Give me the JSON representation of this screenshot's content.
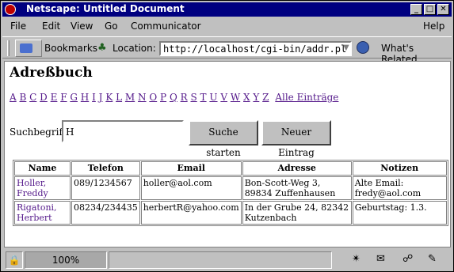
{
  "window": {
    "title": "Netscape: Untitled Document"
  },
  "menu": [
    "File",
    "Edit",
    "View",
    "Go",
    "Communicator",
    "Help"
  ],
  "toolbar": {
    "bookmarks_label": "Bookmarks",
    "location_label": "Location:",
    "url": "http://localhost/cgi-bin/addr.pl",
    "related_label": "What's Related"
  },
  "page": {
    "heading": "Adreßbuch",
    "letters": [
      "A",
      "B",
      "C",
      "D",
      "E",
      "F",
      "G",
      "H",
      "I",
      "J",
      "K",
      "L",
      "M",
      "N",
      "O",
      "P",
      "Q",
      "R",
      "S",
      "T",
      "U",
      "V",
      "W",
      "X",
      "Y",
      "Z"
    ],
    "all_entries": "Alle Einträge",
    "search_label": "Suchbegriff:",
    "search_value": "H",
    "search_button": "Suche starten",
    "new_entry_button": "Neuer Eintrag",
    "table": {
      "headers": [
        "Name",
        "Telefon",
        "Email",
        "Adresse",
        "Notizen"
      ],
      "rows": [
        {
          "name": "Holler, Freddy",
          "phone": "089/1234567",
          "email": "holler@aol.com",
          "address": "Bon-Scott-Weg 3, 89834 Zuffenhausen",
          "notes": "Alte Email: fredy@aol.com"
        },
        {
          "name": "Rigatoni, Herbert",
          "phone": "08234/234435",
          "email": "herbertR@yahoo.com",
          "address": "In der Grube 24, 82342 Kutzenbach",
          "notes": "Geburtstag: 1.3."
        }
      ]
    }
  },
  "status": {
    "progress": "100%"
  }
}
